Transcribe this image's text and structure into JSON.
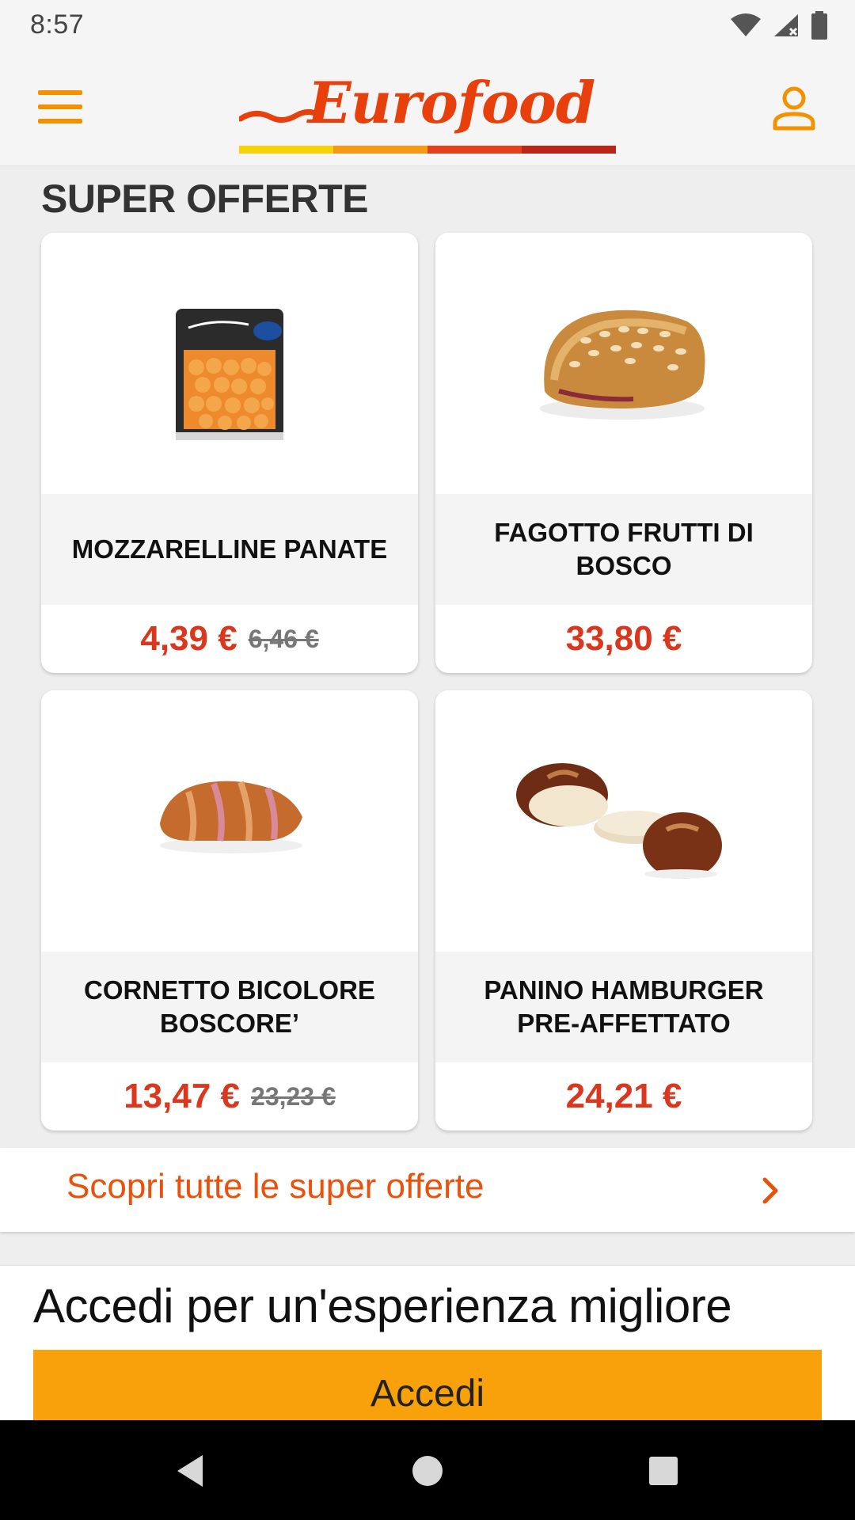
{
  "status_bar": {
    "time": "8:57"
  },
  "header": {
    "brand": "Eurofood",
    "stripe_colors": [
      "#f5d20a",
      "#f39a17",
      "#e3401d",
      "#b9241b"
    ],
    "menu_icon": "hamburger-menu-icon",
    "account_icon": "user-account-icon"
  },
  "section": {
    "title": "SUPER OFFERTE"
  },
  "products": [
    {
      "name": "MOZZARELLINE PANATE",
      "price": "4,39 €",
      "old_price": "6,46 €"
    },
    {
      "name": "FAGOTTO FRUTTI DI BOSCO",
      "price": "33,80 €",
      "old_price": ""
    },
    {
      "name": "CORNETTO BICOLORE BOSCORE’",
      "price": "13,47 €",
      "old_price": "23,23 €"
    },
    {
      "name": "PANINO HAMBURGER PRE-AFFETTATO",
      "price": "24,21 €",
      "old_price": ""
    }
  ],
  "see_all": {
    "label": "Scopri tutte le super offerte",
    "icon": "chevron-right-icon"
  },
  "login": {
    "title": "Accedi per un'esperienza migliore",
    "button_label": "Accedi"
  },
  "colors": {
    "accent": "#f39200",
    "price": "#d9381e",
    "login_button": "#f9a10b",
    "link": "#e8520c"
  }
}
